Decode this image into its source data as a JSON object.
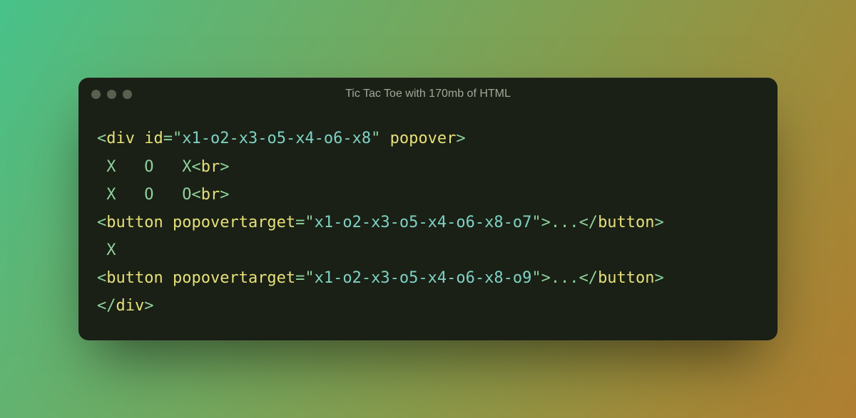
{
  "window": {
    "title": "Tic Tac Toe with 170mb of HTML"
  },
  "code": {
    "l1": {
      "open": "<",
      "tag": "div",
      "sp": " ",
      "attr1": "id",
      "eq": "=",
      "q1": "\"",
      "val1": "x1-o2-x3-o5-x4-o6-x8",
      "q2": "\"",
      "sp2": " ",
      "attr2": "popover",
      "close": ">"
    },
    "l2": {
      "txt": " X   O   X",
      "open": "<",
      "tag": "br",
      "close": ">"
    },
    "l3": {
      "txt": " X   O   O",
      "open": "<",
      "tag": "br",
      "close": ">"
    },
    "l4": {
      "open": "<",
      "tag": "button",
      "sp": " ",
      "attr": "popovertarget",
      "eq": "=",
      "q1": "\"",
      "val": "x1-o2-x3-o5-x4-o6-x8-o7",
      "q2": "\"",
      "close": ">",
      "content": "...",
      "open2": "</",
      "tag2": "button",
      "close2": ">"
    },
    "l5": {
      "txt": " X"
    },
    "l6": {
      "open": "<",
      "tag": "button",
      "sp": " ",
      "attr": "popovertarget",
      "eq": "=",
      "q1": "\"",
      "val": "x1-o2-x3-o5-x4-o6-x8-o9",
      "q2": "\"",
      "close": ">",
      "content": "...",
      "open2": "</",
      "tag2": "button",
      "close2": ">"
    },
    "l7": {
      "open": "</",
      "tag": "div",
      "close": ">"
    }
  }
}
